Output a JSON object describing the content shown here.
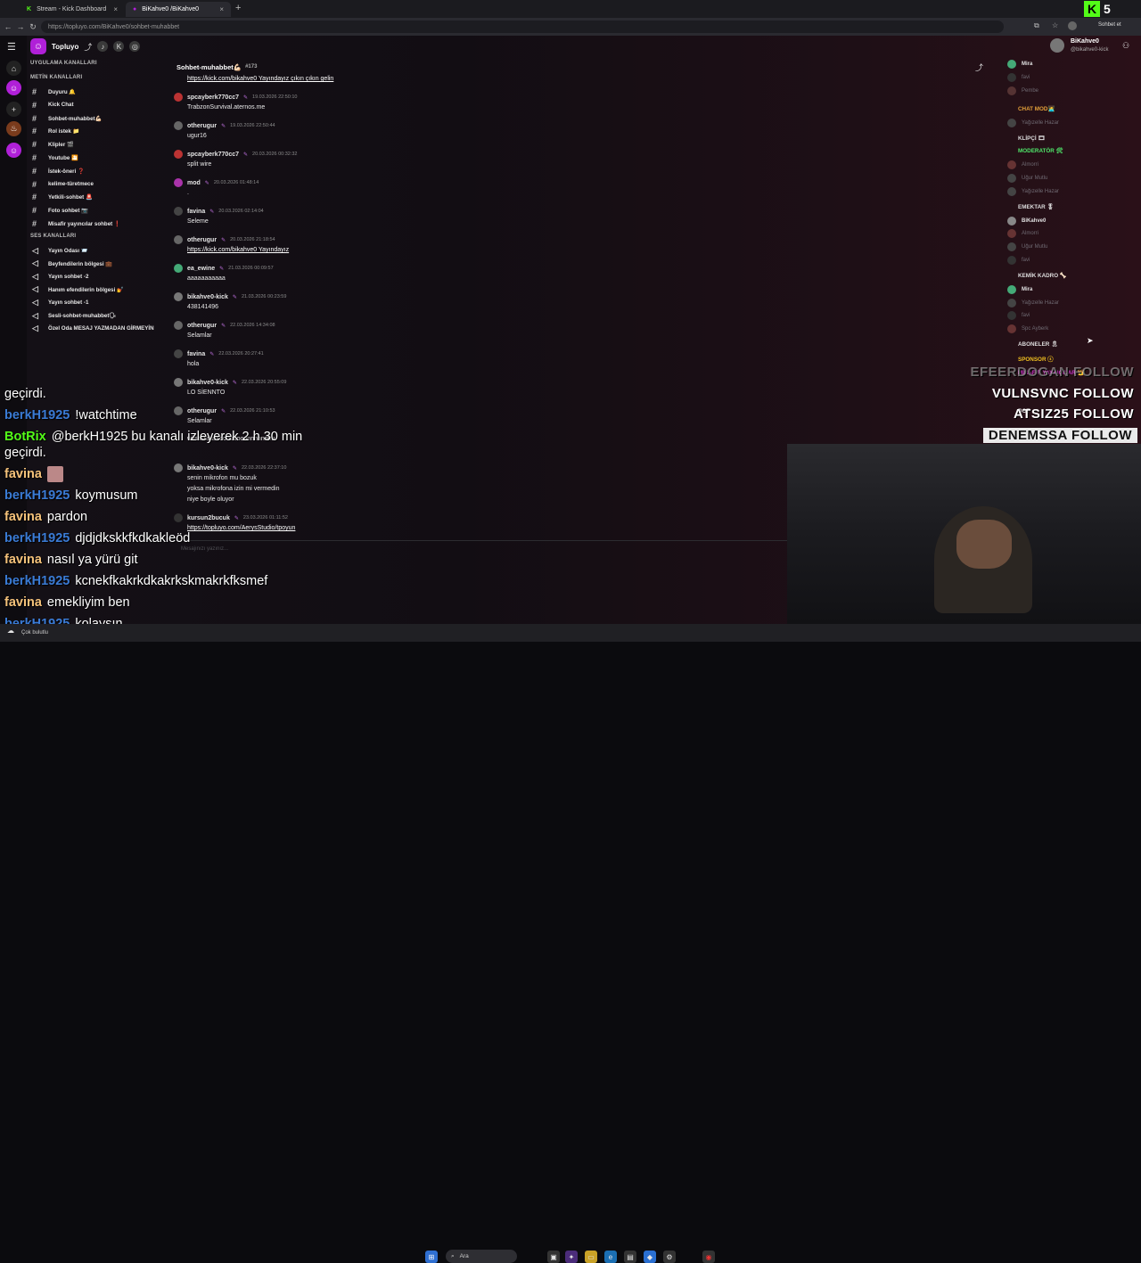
{
  "browser": {
    "tabs": [
      {
        "label": "Stream - Kick Dashboard",
        "active": false
      },
      {
        "label": "BiKahve0 /BiKahve0",
        "active": true
      }
    ],
    "url": "https://topluyo.com/BiKahve0/sohbet-muhabbet",
    "profile_label": "Sohbet et",
    "new_tab": "+",
    "close": "×"
  },
  "app": {
    "name": "Topluyo",
    "user": {
      "name": "BiKahve0",
      "handle": "@bikahve0-kick"
    },
    "sidebar": {
      "section_app": "UYGULAMA KANALLARI",
      "section_text": "METİN KANALLARI",
      "text_channels": [
        "Duyuru 🔔",
        "Kick Chat",
        "Sohbet-muhabbet💪🏻",
        "Rol istek 📁",
        "Klipler 🎬",
        "Youtube 🎦",
        "İstek-öneri ❓",
        "kelime-türetmece",
        "Yetkili-sohbet 🚨",
        "Foto sohbet 📷",
        "Misafir yayıncılar sohbet ❗"
      ],
      "section_voice": "SES KANALLARI",
      "voice_channels": [
        "Yayın Odası 📨",
        "Beyfendilerin bölgesi 💼",
        "Yayın sohbet -2",
        "Hanım efendilerin bölgesi 💅",
        "Yayın sohbet -1",
        "Sesli-sohbet-muhabbet🗣",
        "Özel Oda MESAJ YAZMADAN GİRMEYİN"
      ]
    },
    "channel": {
      "title": "Sohbet-muhabbet💪🏻",
      "count": "#173"
    },
    "messages": [
      {
        "user": "",
        "time": "",
        "text": "https://kick.com/bikahve0 Yayındayız çıkın çıkın gelin",
        "link": true,
        "color": "#3a6"
      },
      {
        "user": "spcayberk770cc7",
        "time": "19.03.2026 22:50:10",
        "text": "TrabzonSurvival.aternos.me",
        "link": false,
        "color": "#b33"
      },
      {
        "user": "otherugur",
        "time": "19.03.2026 22:50:44",
        "text": "ugur16",
        "link": false,
        "color": "#666"
      },
      {
        "user": "spcayberk770cc7",
        "time": "20.03.2026 00:32:32",
        "text": "split wire",
        "link": false,
        "color": "#b33"
      },
      {
        "user": "mod",
        "time": "20.03.2026 01:48:14",
        "text": ".",
        "link": false,
        "color": "#a3a"
      },
      {
        "user": "favina",
        "time": "20.03.2026 02:14:04",
        "text": "Seleme",
        "link": false,
        "color": "#444"
      },
      {
        "user": "otherugur",
        "time": "20.03.2026 21:18:54",
        "text": "https://kick.com/bikahve0 Yayındayız",
        "link": true,
        "color": "#666"
      },
      {
        "user": "ea_ewine",
        "time": "21.03.2026 00:09:57",
        "text": "aaaaaaaaaaa",
        "link": false,
        "color": "#4a7"
      },
      {
        "user": "bikahve0-kick",
        "time": "21.03.2026 00:23:59",
        "text": "438141496",
        "link": false,
        "color": "#777"
      },
      {
        "user": "otherugur",
        "time": "22.03.2026 14:34:08",
        "text": "Selamlar",
        "link": false,
        "color": "#666"
      },
      {
        "user": "favina",
        "time": "22.03.2026 20:27:41",
        "text": "hola",
        "link": false,
        "color": "#444"
      },
      {
        "user": "bikahve0-kick",
        "time": "22.03.2026 20:55:09",
        "text": "LO SİENNTO",
        "link": false,
        "color": "#777"
      },
      {
        "user": "otherugur",
        "time": "22.03.2026 21:10:53",
        "text": "Selamlar",
        "link": false,
        "color": "#666"
      },
      {
        "user": "",
        "time": "",
        "text": "wilssssssssoooooooonnnnnnnn",
        "link": false,
        "color": "#555"
      },
      {
        "user": "bikahve0-kick",
        "time": "22.03.2026 22:37:10",
        "text": "senin mikrofon mu bozuk\nyoksa mikrofona izin mi vermedin\nniye boyle oluyor",
        "link": false,
        "color": "#777"
      },
      {
        "user": "kursun2bucuk",
        "time": "23.03.2026 01:11:52",
        "text": "https://topluyo.com/AerysStudio/tpoyun",
        "link": true,
        "color": "#333"
      }
    ],
    "composer_placeholder": "Mesajınızı yazınız...",
    "members": {
      "top": [
        {
          "name": "Mira",
          "online": true,
          "color": "#4a7"
        },
        {
          "name": "favi",
          "online": false,
          "color": "#333"
        },
        {
          "name": "Pembe",
          "online": false,
          "color": "#533"
        }
      ],
      "role_chat_mod": "CHAT MOD🧑‍💻",
      "chat_mod": [
        {
          "name": "Yağızelle Hazar",
          "online": false,
          "color": "#444"
        }
      ],
      "role_klipci": "KLİPÇİ 🎞",
      "role_moderator": "MODERATÖR 🛠",
      "moderator": [
        {
          "name": "Almorri",
          "online": false,
          "color": "#633"
        },
        {
          "name": "Uğur Mutlu",
          "online": false,
          "color": "#444"
        },
        {
          "name": "Yağızelle Hazar",
          "online": false,
          "color": "#444"
        }
      ],
      "role_emektar": "EMEKTAR 🎖",
      "emektar": [
        {
          "name": "BiKahve0",
          "online": true,
          "color": "#888"
        },
        {
          "name": "Almorri",
          "online": false,
          "color": "#633"
        },
        {
          "name": "Uğur Mutlu",
          "online": false,
          "color": "#444"
        },
        {
          "name": "favi",
          "online": false,
          "color": "#333"
        }
      ],
      "role_kemik": "KEMİK KADRO 🦴",
      "kemik": [
        {
          "name": "Mira",
          "online": true,
          "color": "#4a7"
        },
        {
          "name": "Yağızelle Hazar",
          "online": false,
          "color": "#444"
        },
        {
          "name": "favi",
          "online": false,
          "color": "#333"
        },
        {
          "name": "Spc Ayberk",
          "online": false,
          "color": "#633"
        }
      ],
      "role_aboneler": "ABONELER 🎗",
      "role_sponsor": "SPONSOR ⓢ",
      "role_misafir": "MİSAFİR YAYINCILAR 👑",
      "role_bot": "BOT"
    }
  },
  "overlay": {
    "chat": [
      {
        "name": "",
        "text": "geçirdi.",
        "color": "#ffffff"
      },
      {
        "name": "berkH1925",
        "text": "!watchtime",
        "color": "#3a7bd5"
      },
      {
        "name": "BotRix",
        "text": "@berkH1925 bu kanalı izleyerek 2 h 30 min",
        "color": "#53fc18"
      },
      {
        "name": "",
        "text": "geçirdi.",
        "color": "#ffffff"
      },
      {
        "name": "favina",
        "text": "",
        "color": "#f5c27a"
      },
      {
        "name": "berkH1925",
        "text": "koymusum",
        "color": "#3a7bd5"
      },
      {
        "name": "favina",
        "text": "pardon",
        "color": "#f5c27a"
      },
      {
        "name": "berkH1925",
        "text": "djdjdkskkfkdkakleöd",
        "color": "#3a7bd5"
      },
      {
        "name": "favina",
        "text": "nasıl ya yürü git",
        "color": "#f5c27a"
      },
      {
        "name": "berkH1925",
        "text": "kcnekfkakrkdkakrkskmakrkfksmef",
        "color": "#3a7bd5"
      },
      {
        "name": "favina",
        "text": "emekliyim ben",
        "color": "#f5c27a"
      },
      {
        "name": "berkH1925",
        "text": "kolaysın",
        "color": "#3a7bd5"
      }
    ],
    "follows": [
      {
        "user": "EFEERDOGAN",
        "label": "FOLLOW",
        "dim": true
      },
      {
        "user": "VULNSVNC",
        "label": "FOLLOW",
        "dim": false
      },
      {
        "user": "ATSIZ25",
        "label": "FOLLOW",
        "dim": false
      },
      {
        "user": "DENEMSSA",
        "label": "FOLLOW",
        "dim": false
      }
    ]
  },
  "taskbar": {
    "search": "Ara",
    "weather": "Çok bulutlu"
  },
  "brand_color": "#53fc18",
  "accent": "#b020d8"
}
